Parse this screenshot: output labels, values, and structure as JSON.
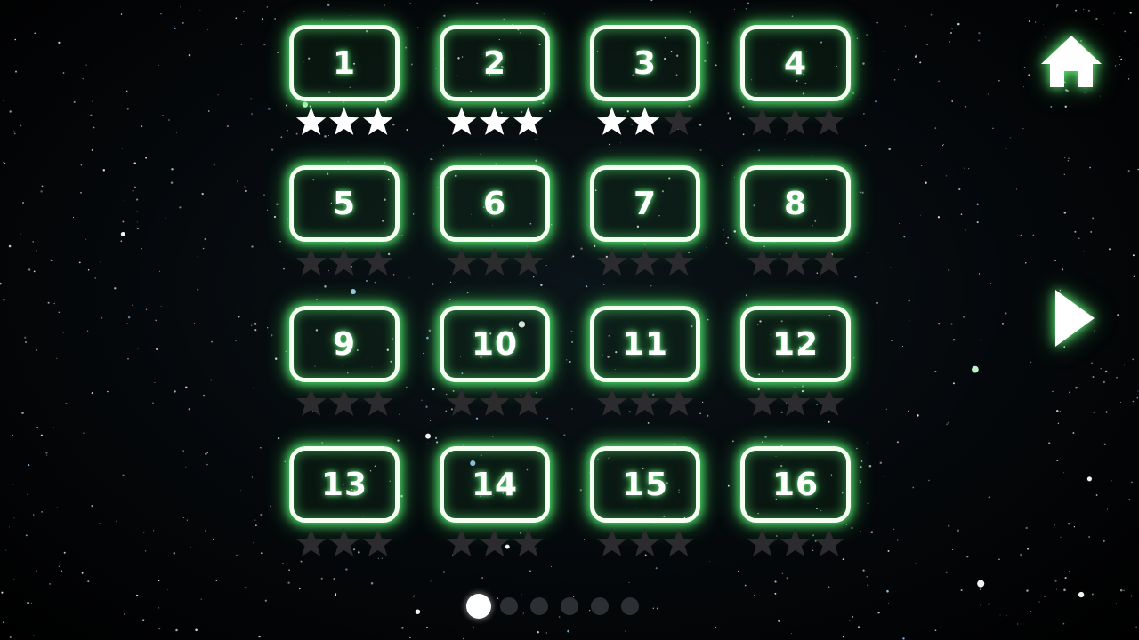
{
  "pages": {
    "current": 1,
    "total": 6
  },
  "navigation": {
    "home_icon": "home-icon",
    "next_icon": "play-arrow-icon"
  },
  "colors": {
    "glow": "#5cff78",
    "border": "#f4fff2",
    "earned_star": "#ffffff",
    "empty_star": "#2c2c2e",
    "active_dot": "#ffffff",
    "inactive_dot": "#2c2f33"
  },
  "levels": [
    {
      "number": "1",
      "stars": 3
    },
    {
      "number": "2",
      "stars": 3
    },
    {
      "number": "3",
      "stars": 2
    },
    {
      "number": "4",
      "stars": 0
    },
    {
      "number": "5",
      "stars": 0
    },
    {
      "number": "6",
      "stars": 0
    },
    {
      "number": "7",
      "stars": 0
    },
    {
      "number": "8",
      "stars": 0
    },
    {
      "number": "9",
      "stars": 0
    },
    {
      "number": "10",
      "stars": 0
    },
    {
      "number": "11",
      "stars": 0
    },
    {
      "number": "12",
      "stars": 0
    },
    {
      "number": "13",
      "stars": 0
    },
    {
      "number": "14",
      "stars": 0
    },
    {
      "number": "15",
      "stars": 0
    },
    {
      "number": "16",
      "stars": 0
    }
  ]
}
